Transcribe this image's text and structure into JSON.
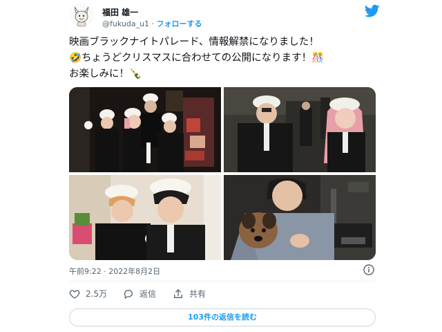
{
  "user": {
    "name": "福田 雄一",
    "handle": "@fukuda_u1",
    "separator": "·",
    "follow_label": "フォローする"
  },
  "tweet": {
    "lines": [
      "映画ブラックナイトパレード、情報解禁になりました！",
      "🤣ちょうどクリスマスに合わせての公開になります！🎊",
      "お楽しみに！🍾"
    ],
    "timestamp": "午前9:22 · 2022年8月2日"
  },
  "photos": [
    {
      "description": "photo-1"
    },
    {
      "description": "photo-2"
    },
    {
      "description": "photo-3"
    },
    {
      "description": "photo-4"
    }
  ],
  "actions": {
    "likes": "2.5万",
    "reply_label": "返信",
    "share_label": "共有"
  },
  "replies_button": "103件の返信を読む",
  "colors": {
    "accent": "#1d9bf0",
    "like": "#536471"
  }
}
